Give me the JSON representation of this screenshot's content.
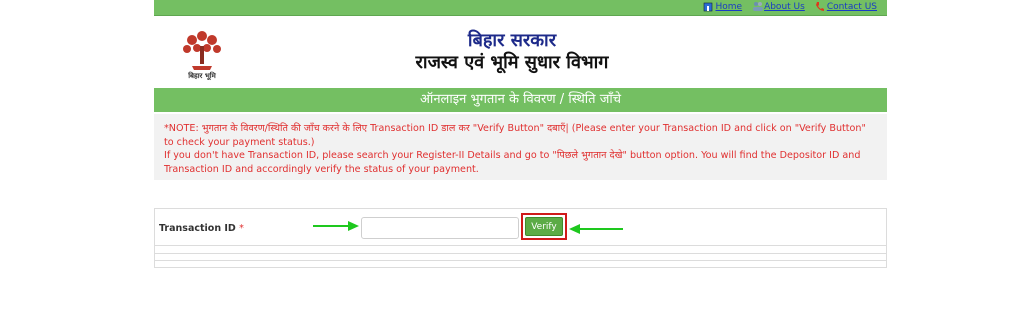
{
  "nav": {
    "home": "Home",
    "about": "About Us",
    "contact": "Contact US"
  },
  "header": {
    "title": "बिहार सरकार",
    "subtitle": "राजस्व एवं भूमि सुधार विभाग",
    "logo_caption": "बिहार भूमि"
  },
  "section": {
    "heading": "ऑनलाइन भुगतान के विवरण / स्थिति जाँचे"
  },
  "note": {
    "line1": "*NOTE: भुगतान के विवरण/स्थिति की जाँच करने के लिए Transaction ID डाल कर \"Verify Button\" दबाएँ| (Please enter your Transaction ID and click on \"Verify Button\"",
    "line2": "to check your payment status.)",
    "line3": "If you don't have Transaction ID, please search your Register-II Details and go to \"पिछले भुगतान देखे\" button option. You will find the Depositor ID and",
    "line4": "Transaction ID and accordingly verify the status of your payment."
  },
  "form": {
    "label": "Transaction ID",
    "required_mark": "*",
    "input_value": "",
    "verify_label": "Verify"
  },
  "colors": {
    "header_green": "#74bf62",
    "note_red": "#e03030",
    "highlight_red": "#d01a1a",
    "arrow_green": "#1ec81e"
  }
}
